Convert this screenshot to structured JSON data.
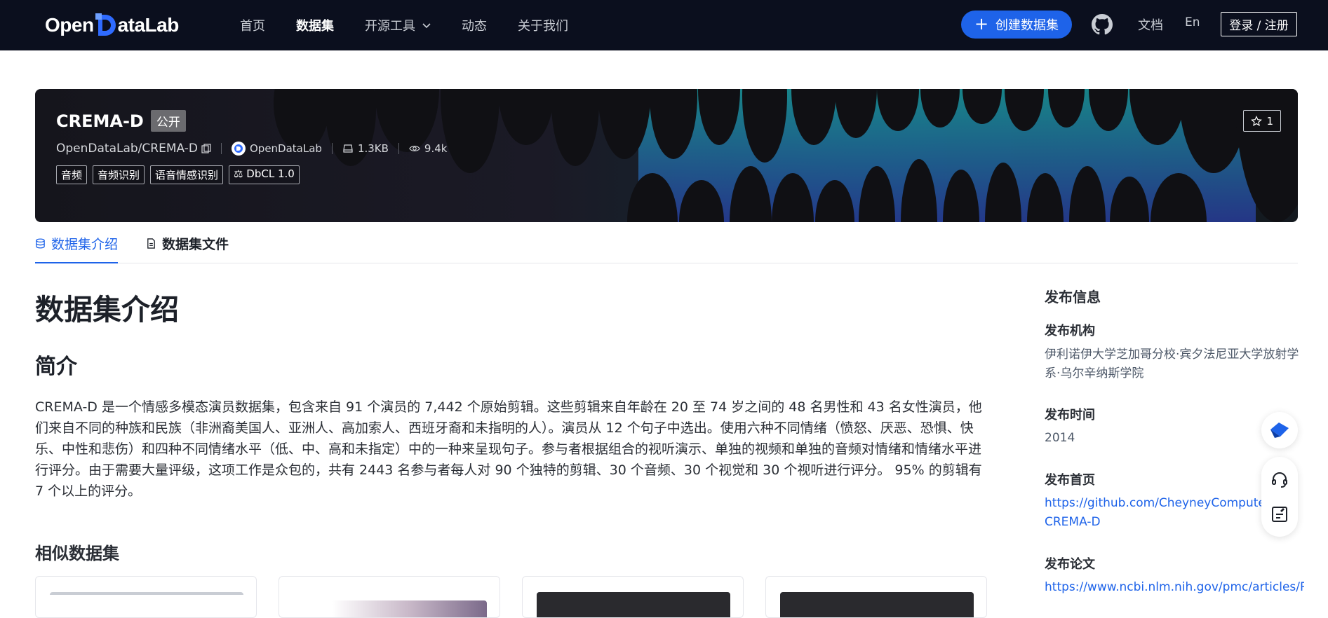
{
  "nav": {
    "logo_pre": "Open",
    "logo_post": "ataLab",
    "items": [
      {
        "label": "首页"
      },
      {
        "label": "数据集"
      },
      {
        "label": "开源工具"
      },
      {
        "label": "动态"
      },
      {
        "label": "关于我们"
      }
    ],
    "create_label": "创建数据集",
    "docs_label": "文档",
    "lang_label": "En",
    "login_label": "登录 / 注册"
  },
  "dataset": {
    "name": "CREMA-D",
    "visibility": "公开",
    "path": "OpenDataLab/CREMA-D",
    "org": "OpenDataLab",
    "size": "1.3KB",
    "views": "9.4k",
    "tags": [
      "音频",
      "音频识别",
      "语音情感识别"
    ],
    "license": "DbCL 1.0",
    "stars": "1"
  },
  "tabs": [
    {
      "label": "数据集介绍"
    },
    {
      "label": "数据集文件"
    }
  ],
  "main": {
    "heading": "数据集介绍",
    "intro_heading": "简介",
    "intro_text": "CREMA-D 是一个情感多模态演员数据集，包含来自 91 个演员的 7,442 个原始剪辑。这些剪辑来自年龄在 20 至 74 岁之间的 48 名男性和 43 名女性演员，他们来自不同的种族和民族（非洲裔美国人、亚洲人、高加索人、西班牙裔和未指明的人）。演员从 12 个句子中选出。使用六种不同情绪（愤怒、厌恶、恐惧、快乐、中性和悲伤）和四种不同情绪水平（低、中、高和未指定）中的一种来呈现句子。参与者根据组合的视听演示、单独的视频和单独的音频对情绪和情绪水平进行评分。由于需要大量评级，这项工作是众包的，共有 2443 名参与者每人对 90 个独特的剪辑、30 个音频、30 个视觉和 30 个视听进行评分。 95% 的剪辑有 7 个以上的评分。",
    "similar_heading": "相似数据集"
  },
  "sidebar": {
    "title": "发布信息",
    "org_label": "发布机构",
    "org_value": "伊利诺伊大学芝加哥分校·宾夕法尼亚大学放射学系·乌尔辛纳斯学院",
    "time_label": "发布时间",
    "time_value": "2014",
    "home_label": "发布首页",
    "home_value": "https://github.com/CheyneyComputerScience/CREMA-D",
    "home_value_line1": "https://github.com/CheyneyComputerSc",
    "home_value_line2": "CREMA-D",
    "paper_label": "发布论文",
    "paper_value": "https://www.ncbi.nlm.nih.gov/pmc/articles/PM"
  },
  "colors": {
    "accent": "#1e63e9",
    "nav_bg": "#0b0f1e"
  }
}
